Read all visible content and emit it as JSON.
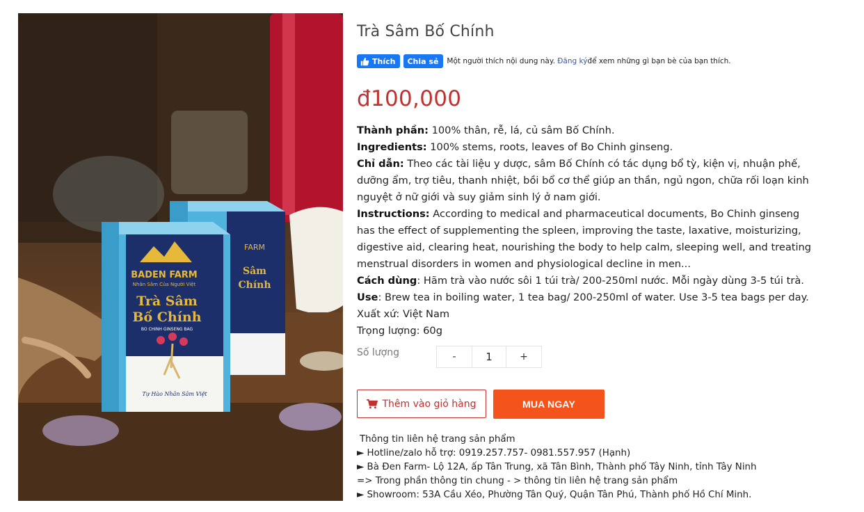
{
  "product": {
    "title": "Trà Sâm Bố Chính",
    "price": "đ100,000"
  },
  "social": {
    "like_label": "Thích",
    "share_label": "Chia sẻ",
    "text_before": "Một người thích nội dung này.",
    "signup_link": "Đăng ký",
    "text_after": "để xem những gì bạn bè của bạn thích."
  },
  "description": {
    "ingredients_vi_label": "Thành phần:",
    "ingredients_vi": " 100% thân, rễ, lá, củ sâm Bố Chính.",
    "ingredients_en_label": "Ingredients:",
    "ingredients_en": " 100% stems, roots, leaves of Bo Chinh ginseng.",
    "guide_vi_label": "Chỉ dẫn:",
    "guide_vi": "  Theo các tài liệu y dược, sâm Bố Chính có tác dụng bổ tỳ, kiện vị, nhuận phế, dưỡng ẩm, trợ tiêu, thanh nhiệt, bồi bổ cơ thể giúp an thần, ngủ ngon, chữa rối loạn kinh nguyệt ở nữ giới và suy giảm sinh lý ở nam giới.",
    "instructions_label": "Instructions:",
    "instructions": " According to medical and pharmaceutical documents, Bo Chinh ginseng has the effect of supplementing the spleen, improving the taste, laxative, moisturizing, digestive aid, clearing heat, nourishing the body to help calm, sleeping well, and treating menstrual disorders in women and physiological decline in men...",
    "usage_vi_label": "Cách dùng",
    "usage_vi": ": Hãm trà vào nước sôi 1 túi trà/ 200-250ml nước. Mỗi ngày dùng 3-5 túi trà.",
    "usage_en_label": "Use",
    "usage_en": ": Brew tea in boiling water, 1 tea bag/ 200-250ml of water. Use 3-5 tea bags per day.",
    "origin": "Xuất xứ: Việt Nam",
    "weight": "Trọng lượng: 60g"
  },
  "quantity": {
    "label": "Số lượng",
    "minus": "-",
    "value": "1",
    "plus": "+"
  },
  "actions": {
    "add_to_cart": "Thêm vào giỏ hàng",
    "buy_now": "MUA NGAY"
  },
  "contact": {
    "heading": "Thông tin liên hệ trang sản phẩm",
    "lines": [
      "► Hotline/zalo hỗ trợ: 0919.257.757- 0981.557.957 (Hạnh)",
      "► Bà Đen Farm- Lộ 12A, ấp Tân Trung, xã Tân Bình, Thành phố Tây Ninh, tỉnh Tây Ninh",
      "=> Trong phần thông tin chung - > thông tin liên hệ trang sản phẩm",
      "► Showroom: 53A Cầu Xéo, Phường Tân Quý, Quận Tân Phú, Thành phố Hồ Chí Minh."
    ]
  },
  "photo": {
    "brand": "BADEN FARM",
    "brand_tagline": "Nhân Sâm Của Người Việt",
    "box_title_1": "Trà Sâm",
    "box_title_2": "Bố Chính",
    "box_subtitle": "BO CHINH GINSENG BAG",
    "box_footer": "Tự Hào Nhân Sâm Việt",
    "colors": {
      "box_blue": "#4fb3dd",
      "box_navy": "#1c2f6b",
      "gold": "#e7b93a",
      "bottle_red": "#b3142d"
    }
  },
  "theme": {
    "price_color": "#c0312f",
    "buy_color": "#f4531c",
    "fb_blue": "#1877f2"
  }
}
